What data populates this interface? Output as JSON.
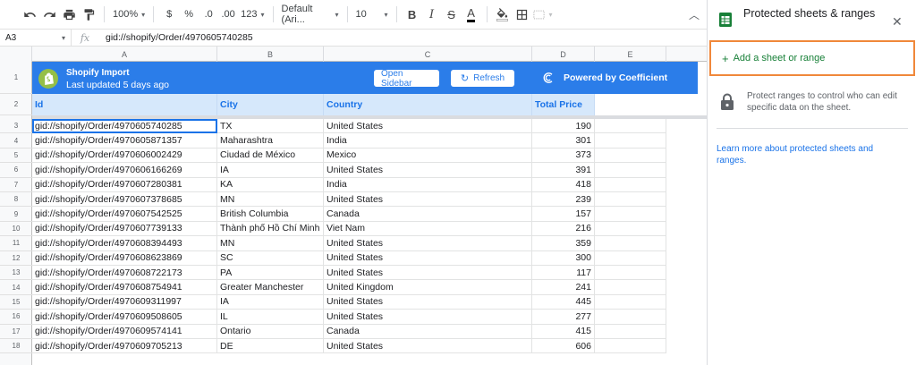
{
  "toolbar": {
    "zoom": "100%",
    "currency": "$",
    "percent": "%",
    "dec_decrease": ".0",
    "dec_increase": ".00",
    "more_formats": "123",
    "font": "Default (Ari...",
    "font_size": "10",
    "bold": "B",
    "italic": "I",
    "strike": "S",
    "text_color": "A"
  },
  "formula_bar": {
    "cell_ref": "A3",
    "fx": "fx",
    "value": "gid://shopify/Order/4970605740285"
  },
  "columns": [
    "A",
    "B",
    "C",
    "D",
    "E"
  ],
  "row_numbers": [
    "1",
    "2",
    "3",
    "4",
    "5",
    "6",
    "7",
    "8",
    "9",
    "10",
    "11",
    "12",
    "13",
    "14",
    "15",
    "16",
    "17",
    "18"
  ],
  "banner": {
    "title": "Shopify Import",
    "subtitle": "Last updated 5 days ago",
    "open_sidebar": "Open Sidebar",
    "refresh": "Refresh",
    "powered_by": "Powered by Coefficient"
  },
  "headers": [
    "Id",
    "City",
    "Country",
    "Total Price"
  ],
  "rows": [
    [
      "gid://shopify/Order/4970605740285",
      "TX",
      "United States",
      "190"
    ],
    [
      "gid://shopify/Order/4970605871357",
      "Maharashtra",
      "India",
      "301"
    ],
    [
      "gid://shopify/Order/4970606002429",
      "Ciudad de México",
      "Mexico",
      "373"
    ],
    [
      "gid://shopify/Order/4970606166269",
      "IA",
      "United States",
      "391"
    ],
    [
      "gid://shopify/Order/4970607280381",
      "KA",
      "India",
      "418"
    ],
    [
      "gid://shopify/Order/4970607378685",
      "MN",
      "United States",
      "239"
    ],
    [
      "gid://shopify/Order/4970607542525",
      "British Columbia",
      "Canada",
      "157"
    ],
    [
      "gid://shopify/Order/4970607739133",
      "Thành phố Hồ Chí Minh",
      "Viet Nam",
      "216"
    ],
    [
      "gid://shopify/Order/4970608394493",
      "MN",
      "United States",
      "359"
    ],
    [
      "gid://shopify/Order/4970608623869",
      "SC",
      "United States",
      "300"
    ],
    [
      "gid://shopify/Order/4970608722173",
      "PA",
      "United States",
      "117"
    ],
    [
      "gid://shopify/Order/4970608754941",
      "Greater Manchester",
      "United Kingdom",
      "241"
    ],
    [
      "gid://shopify/Order/4970609311997",
      "IA",
      "United States",
      "445"
    ],
    [
      "gid://shopify/Order/4970609508605",
      "IL",
      "United States",
      "277"
    ],
    [
      "gid://shopify/Order/4970609574141",
      "Ontario",
      "Canada",
      "415"
    ],
    [
      "gid://shopify/Order/4970609705213",
      "DE",
      "United States",
      "606"
    ]
  ],
  "panel": {
    "title": "Protected sheets & ranges",
    "add_label": "Add a sheet or range",
    "description": "Protect ranges to control who can edit specific data on the sheet.",
    "learn_more": "Learn more about protected sheets and ranges."
  },
  "colors": {
    "banner": "#2b7de9",
    "header_fill": "#d6e8fb",
    "header_text": "#1a73e8",
    "add_text": "#188038",
    "highlight": "#f0883a",
    "sheets_green": "#188038"
  }
}
